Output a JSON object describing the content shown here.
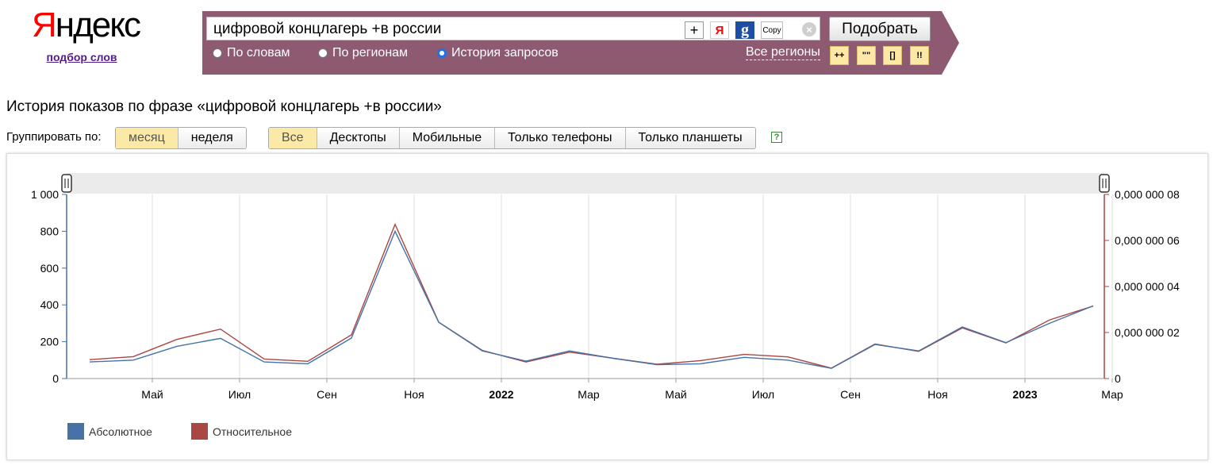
{
  "logo": {
    "first_letter": "Я",
    "rest": "ндекс",
    "link": "подбор слов"
  },
  "search": {
    "value": "цифровой концлагерь +в россии",
    "plus_label": "+",
    "ya_label": "Я",
    "g_label": "g",
    "copy_label": "Copy",
    "clear_label": "×",
    "submit_label": "Подобрать",
    "modes": [
      {
        "label": "По словам",
        "selected": false
      },
      {
        "label": "По регионам",
        "selected": false
      },
      {
        "label": "История запросов",
        "selected": true
      }
    ],
    "regions_label": "Все регионы",
    "operators": [
      "++",
      "\"\"",
      "[]",
      "!!"
    ]
  },
  "page": {
    "heading": "История показов по фразе «цифровой концлагерь +в россии»"
  },
  "grouping": {
    "label": "Группировать по:",
    "options": [
      {
        "label": "месяц",
        "active": true
      },
      {
        "label": "неделя",
        "active": false
      }
    ]
  },
  "devices": {
    "options": [
      {
        "label": "Все",
        "active": true
      },
      {
        "label": "Десктопы",
        "active": false
      },
      {
        "label": "Мобильные",
        "active": false
      },
      {
        "label": "Только телефоны",
        "active": false
      },
      {
        "label": "Только планшеты",
        "active": false
      }
    ],
    "help_label": "?"
  },
  "chart_data": {
    "type": "line",
    "y_left_ticks": [
      "0",
      "200",
      "400",
      "600",
      "800",
      "1 000"
    ],
    "y_left_range": [
      0,
      1000
    ],
    "y_right_ticks": [
      "0",
      "0,000 000 02",
      "0,000 000 04",
      "0,000 000 06",
      "0,000 000 08"
    ],
    "y_right_range": [
      0,
      8e-08
    ],
    "x_ticks": [
      {
        "label": "Май",
        "bold": false
      },
      {
        "label": "Июл",
        "bold": false
      },
      {
        "label": "Сен",
        "bold": false
      },
      {
        "label": "Ноя",
        "bold": false
      },
      {
        "label": "2022",
        "bold": true
      },
      {
        "label": "Мар",
        "bold": false
      },
      {
        "label": "Май",
        "bold": false
      },
      {
        "label": "Июл",
        "bold": false
      },
      {
        "label": "Сен",
        "bold": false
      },
      {
        "label": "Ноя",
        "bold": false
      },
      {
        "label": "2023",
        "bold": true
      },
      {
        "label": "Мар",
        "bold": false
      }
    ],
    "x": [
      "2021-04",
      "2021-05",
      "2021-06",
      "2021-07",
      "2021-08",
      "2021-09",
      "2021-10",
      "2021-11",
      "2021-12",
      "2022-01",
      "2022-02",
      "2022-03",
      "2022-04",
      "2022-05",
      "2022-06",
      "2022-07",
      "2022-08",
      "2022-09",
      "2022-10",
      "2022-11",
      "2022-12",
      "2023-01",
      "2023-02",
      "2023-03"
    ],
    "series": [
      {
        "name": "Абсолютное",
        "color": "#4572a7",
        "axis": "left",
        "values": [
          90,
          100,
          175,
          218,
          90,
          80,
          220,
          800,
          305,
          150,
          95,
          150,
          110,
          75,
          80,
          115,
          100,
          55,
          185,
          150,
          280,
          195,
          300,
          395
        ]
      },
      {
        "name": "Относительное",
        "color": "#aa4643",
        "axis": "right",
        "values": [
          8.2e-09,
          9.5e-09,
          1.7e-08,
          2.15e-08,
          8.5e-09,
          7.5e-09,
          1.9e-08,
          6.7e-08,
          2.45e-08,
          1.22e-08,
          7.2e-09,
          1.15e-08,
          8.8e-09,
          6.2e-09,
          7.8e-09,
          1.05e-08,
          9.4e-09,
          4.5e-09,
          1.5e-08,
          1.18e-08,
          2.2e-08,
          1.55e-08,
          2.55e-08,
          3.15e-08
        ]
      }
    ],
    "legend": "bottom-left",
    "grid": true
  }
}
